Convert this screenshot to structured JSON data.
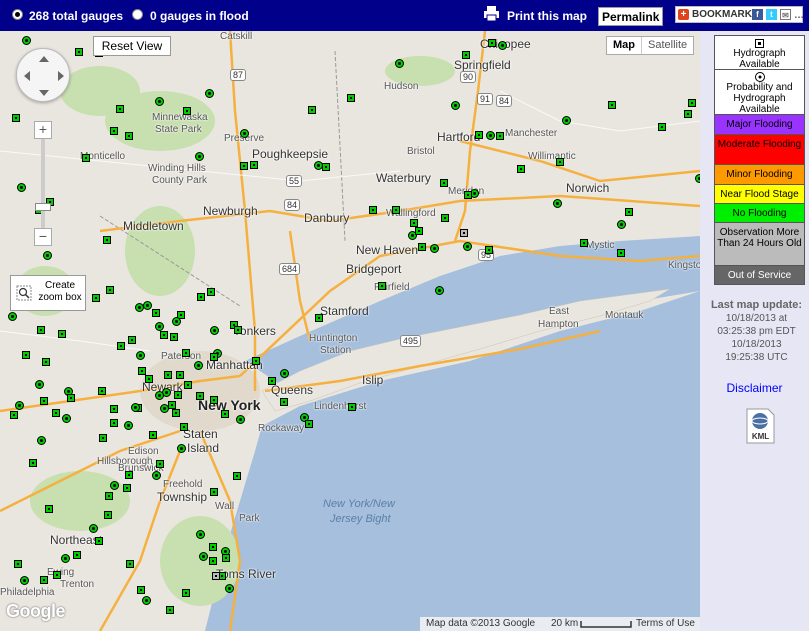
{
  "topbar": {
    "gauges_total": "268 total gauges",
    "gauges_flood": "0 gauges in flood",
    "print": "Print this map",
    "permalink": "Permalink",
    "bookmark": "BOOKMARK"
  },
  "map_controls": {
    "reset_view": "Reset View",
    "zoom_in": "+",
    "zoom_out": "−",
    "create_zoom_box": "Create zoom box",
    "map_type_map": "Map",
    "map_type_satellite": "Satellite",
    "google": "Google",
    "map_data": "Map data ©2013 Google",
    "scale": "20 km",
    "terms": "Terms of Use"
  },
  "places": [
    {
      "name": "Catskill",
      "cls": "small"
    },
    {
      "name": "Chicopee",
      "cls": ""
    },
    {
      "name": "Springfield",
      "cls": ""
    },
    {
      "name": "Hudson",
      "cls": "small"
    },
    {
      "name": "Minnewaska",
      "cls": "small"
    },
    {
      "name": "State Park",
      "cls": "small"
    },
    {
      "name": "Preserve",
      "cls": "small"
    },
    {
      "name": "Hartford",
      "cls": ""
    },
    {
      "name": "Manchester",
      "cls": "small"
    },
    {
      "name": "Bristol",
      "cls": "small"
    },
    {
      "name": "Willimantic",
      "cls": "small"
    },
    {
      "name": "Poughkeepsie",
      "cls": ""
    },
    {
      "name": "Monticello",
      "cls": "small"
    },
    {
      "name": "Winding Hills",
      "cls": "small"
    },
    {
      "name": "County Park",
      "cls": "small"
    },
    {
      "name": "Waterbury",
      "cls": ""
    },
    {
      "name": "Meriden",
      "cls": "small"
    },
    {
      "name": "Norwich",
      "cls": ""
    },
    {
      "name": "Newburgh",
      "cls": ""
    },
    {
      "name": "Danbury",
      "cls": ""
    },
    {
      "name": "Wallingford",
      "cls": "small"
    },
    {
      "name": "Middletown",
      "cls": ""
    },
    {
      "name": "New Haven",
      "cls": ""
    },
    {
      "name": "Mystic",
      "cls": "small"
    },
    {
      "name": "Kingstown",
      "cls": "small"
    },
    {
      "name": "Bridgeport",
      "cls": ""
    },
    {
      "name": "Fairfield",
      "cls": "small"
    },
    {
      "name": "Stamford",
      "cls": ""
    },
    {
      "name": "East",
      "cls": "small"
    },
    {
      "name": "Hampton",
      "cls": "small"
    },
    {
      "name": "Montauk",
      "cls": "small"
    },
    {
      "name": "Yonkers",
      "cls": ""
    },
    {
      "name": "Huntington",
      "cls": "small"
    },
    {
      "name": "Station",
      "cls": "small"
    },
    {
      "name": "Paterson",
      "cls": "small"
    },
    {
      "name": "Manhattan",
      "cls": ""
    },
    {
      "name": "Queens",
      "cls": ""
    },
    {
      "name": "Islip",
      "cls": ""
    },
    {
      "name": "Newark",
      "cls": ""
    },
    {
      "name": "New York",
      "cls": "big"
    },
    {
      "name": "Lindenhurst",
      "cls": "small"
    },
    {
      "name": "Rockaway",
      "cls": "small"
    },
    {
      "name": "Staten",
      "cls": ""
    },
    {
      "name": "Island",
      "cls": ""
    },
    {
      "name": "Edison",
      "cls": "small"
    },
    {
      "name": "Hillsborough",
      "cls": "small"
    },
    {
      "name": "Brunswick",
      "cls": "small"
    },
    {
      "name": "Township",
      "cls": ""
    },
    {
      "name": "Freehold",
      "cls": "small"
    },
    {
      "name": "Wall",
      "cls": "small"
    },
    {
      "name": "Park",
      "cls": "small"
    },
    {
      "name": "Northeast",
      "cls": ""
    },
    {
      "name": "Toms River",
      "cls": ""
    },
    {
      "name": "Philadelphia",
      "cls": "small"
    },
    {
      "name": "Ewing",
      "cls": "small"
    },
    {
      "name": "Trenton",
      "cls": "small"
    }
  ],
  "water_labels": [
    "New York/New",
    "Jersey Bight"
  ],
  "shields": [
    "87",
    "90",
    "91",
    "84",
    "55",
    "684",
    "84",
    "95",
    "495"
  ],
  "legend": {
    "hydrograph": "Hydrograph Available",
    "probability": "Probability and Hydrograph Available",
    "major": "Major Flooding",
    "moderate": "Moderate Flooding",
    "minor": "Minor Flooding",
    "near": "Near Flood Stage",
    "none": "No Flooding",
    "old": "Observation More Than 24 Hours Old",
    "oos": "Out of Service"
  },
  "colors": {
    "major": "#9933ff",
    "moderate": "#ff0000",
    "minor": "#ff9900",
    "near": "#ffff00",
    "none": "#00ee00",
    "old": "#bbbbbb",
    "oos": "#666666",
    "topbar": "#00008b"
  },
  "update": {
    "heading": "Last map update:",
    "local_date": "10/18/2013 at",
    "local_time": "03:25:38 pm EDT",
    "utc_date": "10/18/2013",
    "utc_time": "19:25:38 UTC"
  },
  "disclaimer": "Disclaimer",
  "kml": "KML"
}
